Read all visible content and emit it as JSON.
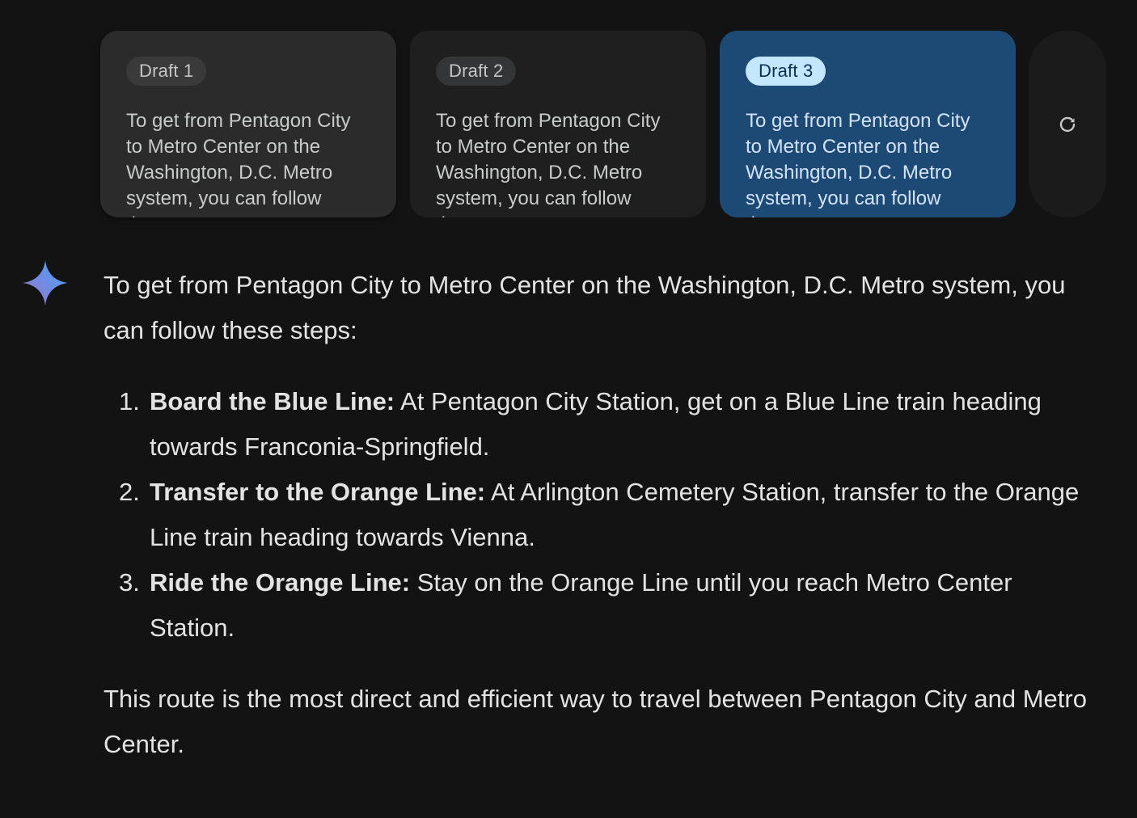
{
  "drafts": [
    {
      "label": "Draft 1",
      "preview": "To get from Pentagon City to Metro Center on the Washington, D.C. Metro system, you can follow these steps:",
      "state": "hovered"
    },
    {
      "label": "Draft 2",
      "preview": "To get from Pentagon City to Metro Center on the Washington, D.C. Metro system, you can follow these steps:",
      "state": "default"
    },
    {
      "label": "Draft 3",
      "preview": "To get from Pentagon City to Metro Center on the Washington, D.C. Metro system, you can follow these steps:",
      "state": "selected"
    }
  ],
  "regenerate": {
    "icon": "refresh-icon"
  },
  "response": {
    "icon": "sparkle-icon",
    "intro": "To get from Pentagon City to Metro Center on the Washington, D.C. Metro system, you can follow these steps:",
    "steps": [
      {
        "num": "1.",
        "title": "Board the Blue Line:",
        "text": "At Pentagon City Station, get on a Blue Line train heading towards Franconia-Springfield."
      },
      {
        "num": "2.",
        "title": "Transfer to the Orange Line:",
        "text": "At Arlington Cemetery Station, transfer to the Orange Line train heading towards Vienna."
      },
      {
        "num": "3.",
        "title": "Ride the Orange Line:",
        "text": "Stay on the Orange Line until you reach Metro Center Station."
      }
    ],
    "closing": "This route is the most direct and efficient way to travel between Pentagon City and Metro Center."
  },
  "colors": {
    "background": "#131313",
    "selected_card": "#1d4975",
    "selected_chip": "#c2e7ff",
    "text": "#e3e3e3"
  }
}
